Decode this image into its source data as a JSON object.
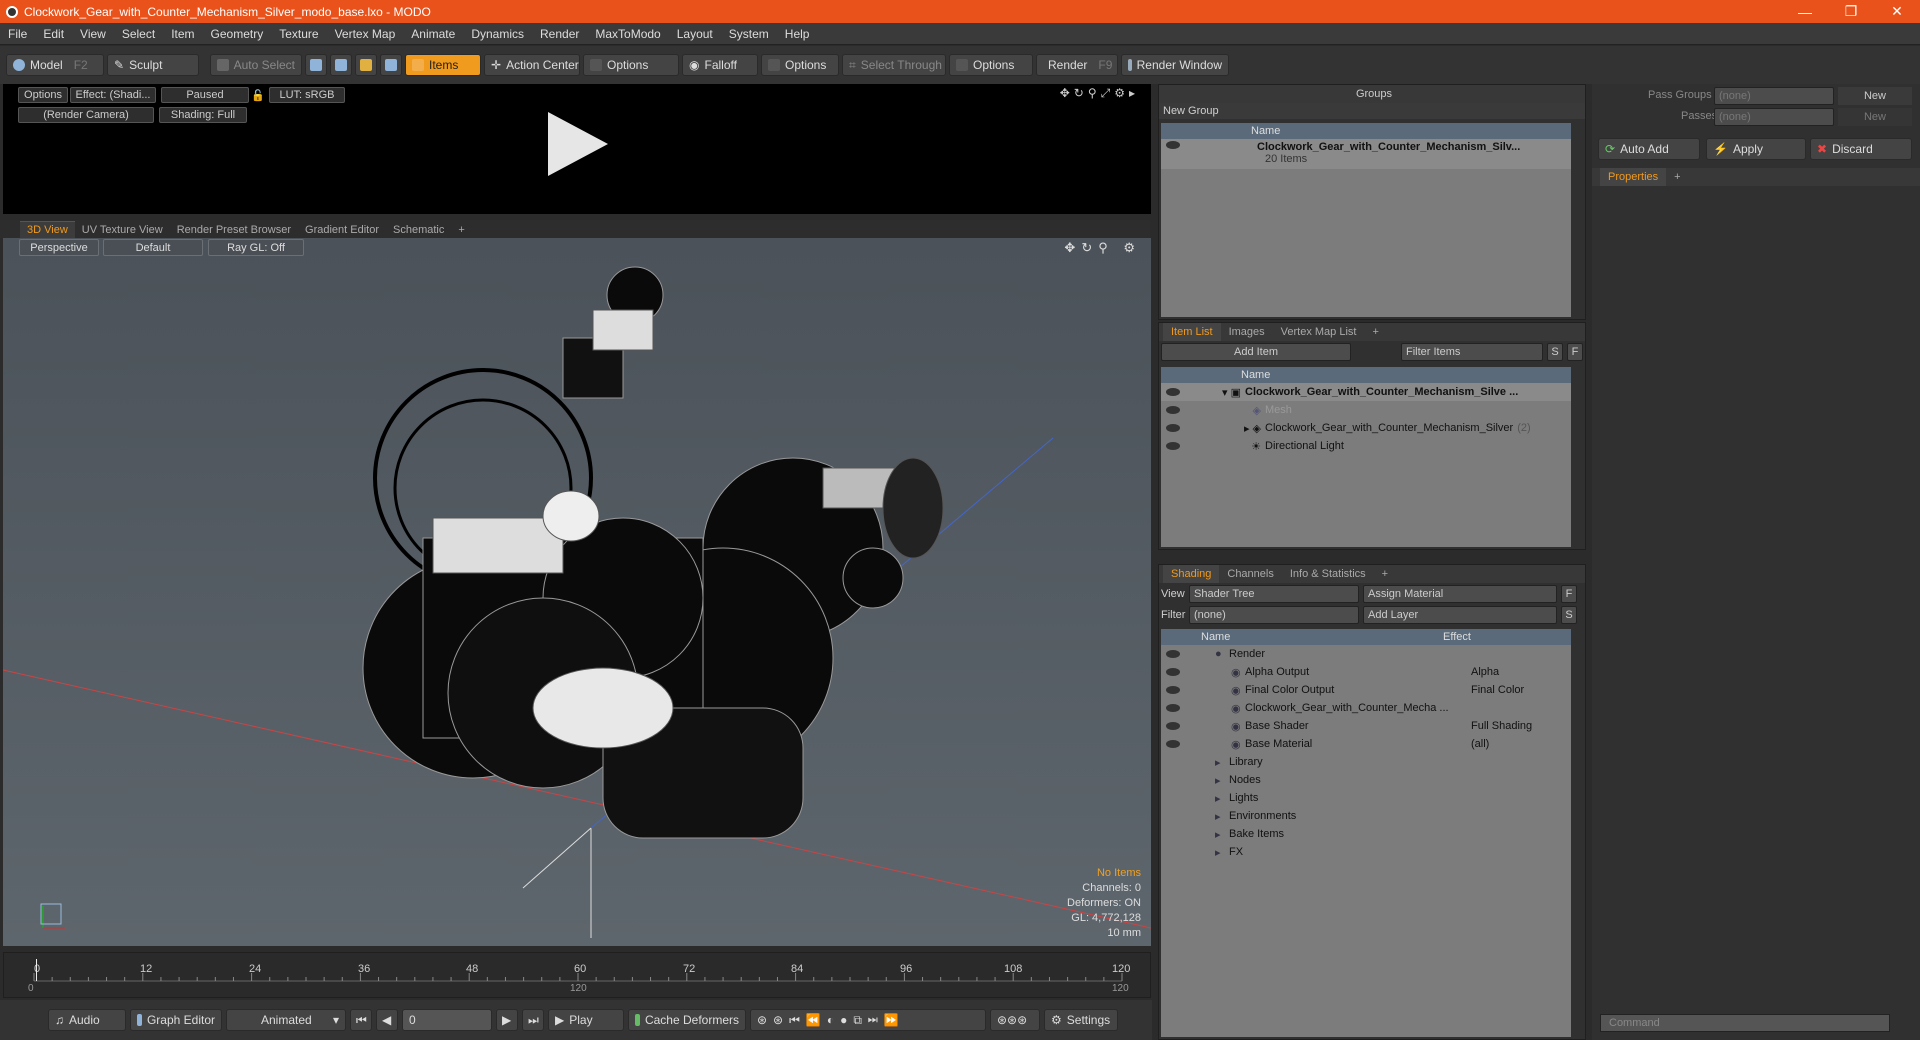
{
  "title": "Clockwork_Gear_with_Counter_Mechanism_Silver_modo_base.lxo - MODO",
  "window_controls": [
    "—",
    "❐",
    "✕"
  ],
  "menu": [
    "File",
    "Edit",
    "View",
    "Select",
    "Item",
    "Geometry",
    "Texture",
    "Vertex Map",
    "Animate",
    "Dynamics",
    "Render",
    "MaxToModo",
    "Layout",
    "System",
    "Help"
  ],
  "toolbar": {
    "model": "Model",
    "model_key": "F2",
    "sculpt": "Sculpt",
    "auto_select": "Auto Select",
    "items": "Items",
    "action_center": "Action Center",
    "options1": "Options",
    "falloff": "Falloff",
    "options2": "Options",
    "select_through": "Select Through",
    "options3": "Options",
    "render": "Render",
    "render_key": "F9",
    "render_window": "Render Window"
  },
  "render_bar": {
    "options": "Options",
    "effect": "Effect: (Shadi...",
    "paused": "Paused",
    "lut": "LUT: sRGB",
    "camera": "(Render Camera)",
    "shading": "Shading: Full"
  },
  "viewport_tabs": [
    "3D View",
    "UV Texture View",
    "Render Preset Browser",
    "Gradient Editor",
    "Schematic",
    "+"
  ],
  "viewport": {
    "perspective": "Perspective",
    "default": "Default",
    "raygl": "Ray GL: Off"
  },
  "stats": {
    "no_items": "No Items",
    "channels": "Channels: 0",
    "deformers": "Deformers: ON",
    "gl": "GL: 4,772,128",
    "size": "10 mm"
  },
  "timeline": {
    "ticks": [
      "0",
      "12",
      "24",
      "36",
      "48",
      "60",
      "72",
      "84",
      "96",
      "108",
      "120"
    ],
    "start": "0",
    "mid": "120",
    "end": "120"
  },
  "bottom": {
    "audio": "Audio",
    "graph_editor": "Graph Editor",
    "animated": "Animated",
    "frame": "0",
    "play": "Play",
    "cache_deformers": "Cache Deformers",
    "settings": "Settings"
  },
  "groups": {
    "title": "Groups",
    "new_group": "New Group",
    "name_col": "Name",
    "item_name": "Clockwork_Gear_with_Counter_Mechanism_Silv...",
    "item_count": "20 Items"
  },
  "pass": {
    "pass_groups": "Pass Groups",
    "passes": "Passes",
    "none1": "(none)",
    "none2": "(none)",
    "new1": "New",
    "new2": "New",
    "auto_add": "Auto Add",
    "apply": "Apply",
    "discard": "Discard",
    "properties": "Properties",
    "plus": "+"
  },
  "itemlist": {
    "tabs": [
      "Item List",
      "Images",
      "Vertex Map List",
      "+"
    ],
    "add_item": "Add Item",
    "filter": "Filter Items",
    "s": "S",
    "f": "F",
    "name_col": "Name",
    "rows": [
      {
        "label": "Clockwork_Gear_with_Counter_Mechanism_Silve ...",
        "indent": 0,
        "bold": true
      },
      {
        "label": "Mesh",
        "indent": 1,
        "bold": false
      },
      {
        "label": "Clockwork_Gear_with_Counter_Mechanism_Silver",
        "suffix": "(2)",
        "indent": 1,
        "bold": false
      },
      {
        "label": "Directional Light",
        "indent": 1,
        "bold": false
      }
    ]
  },
  "shading": {
    "tabs": [
      "Shading",
      "Channels",
      "Info & Statistics",
      "+"
    ],
    "view_label": "View",
    "view_value": "Shader Tree",
    "assign": "Assign Material",
    "f": "F",
    "filter_label": "Filter",
    "filter_value": "(none)",
    "add_layer": "Add Layer",
    "s": "S",
    "name_col": "Name",
    "effect_col": "Effect",
    "rows": [
      {
        "name": "Render",
        "effect": "",
        "indent": 0
      },
      {
        "name": "Alpha Output",
        "effect": "Alpha",
        "indent": 1
      },
      {
        "name": "Final Color Output",
        "effect": "Final Color",
        "indent": 1
      },
      {
        "name": "Clockwork_Gear_with_Counter_Mecha ...",
        "effect": "",
        "indent": 1
      },
      {
        "name": "Base Shader",
        "effect": "Full Shading",
        "indent": 1
      },
      {
        "name": "Base Material",
        "effect": "(all)",
        "indent": 1
      },
      {
        "name": "Library",
        "effect": "",
        "indent": 0
      },
      {
        "name": "Nodes",
        "effect": "",
        "indent": 0
      },
      {
        "name": "Lights",
        "effect": "",
        "indent": 0
      },
      {
        "name": "Environments",
        "effect": "",
        "indent": 0
      },
      {
        "name": "Bake Items",
        "effect": "",
        "indent": 0
      },
      {
        "name": "FX",
        "effect": "",
        "indent": 0
      }
    ]
  },
  "command_placeholder": "Command"
}
